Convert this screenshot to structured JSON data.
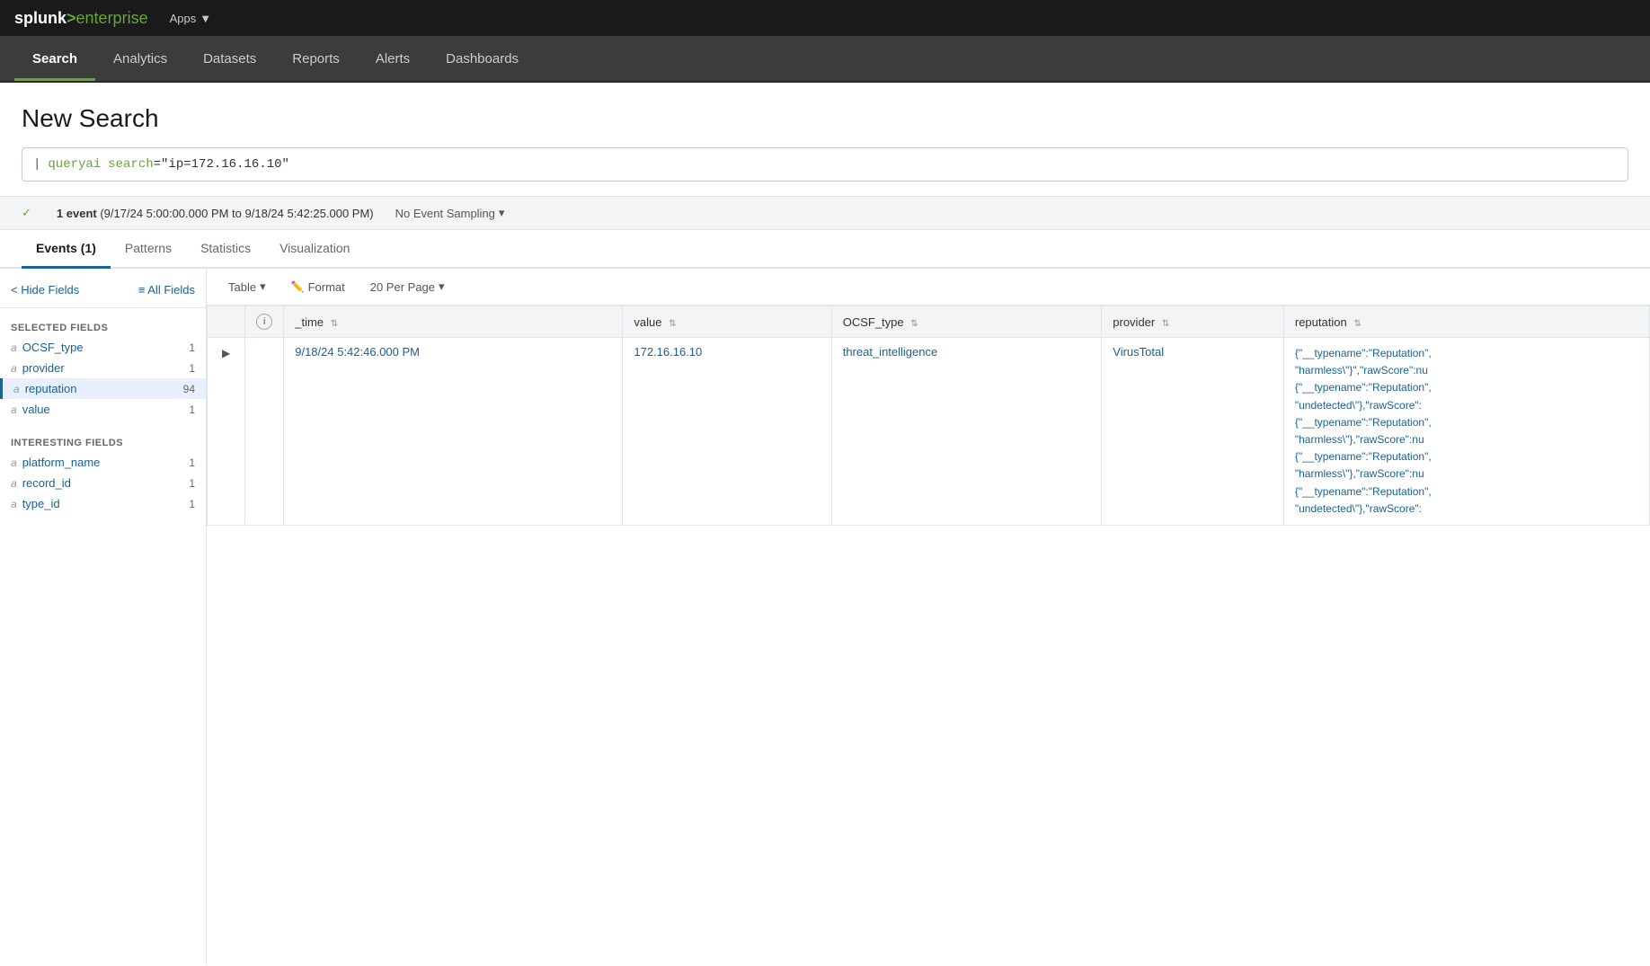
{
  "topbar": {
    "logo": {
      "splunk": "splunk",
      "arrow": ">",
      "enterprise": "enterprise"
    },
    "apps_label": "Apps",
    "apps_arrow": "▼"
  },
  "navbar": {
    "items": [
      {
        "id": "search",
        "label": "Search",
        "active": true
      },
      {
        "id": "analytics",
        "label": "Analytics",
        "active": false
      },
      {
        "id": "datasets",
        "label": "Datasets",
        "active": false
      },
      {
        "id": "reports",
        "label": "Reports",
        "active": false
      },
      {
        "id": "alerts",
        "label": "Alerts",
        "active": false
      },
      {
        "id": "dashboards",
        "label": "Dashboards",
        "active": false
      }
    ]
  },
  "page": {
    "title": "New Search",
    "search_query": "| queryai search=\"ip=172.16.16.10\"",
    "search_pipe": "|",
    "search_cmd": "queryai",
    "search_keyword": "search",
    "search_value": "=\"ip=172.16.16.10\"",
    "status_check": "✓",
    "status_event_count": "1 event",
    "status_time_range": "(9/17/24 5:00:00.000 PM to 9/18/24 5:42:25.000 PM)",
    "sampling_label": "No Event Sampling",
    "sampling_arrow": "▾"
  },
  "tabs": [
    {
      "id": "events",
      "label": "Events (1)",
      "active": true
    },
    {
      "id": "patterns",
      "label": "Patterns",
      "active": false
    },
    {
      "id": "statistics",
      "label": "Statistics",
      "active": false
    },
    {
      "id": "visualization",
      "label": "Visualization",
      "active": false
    }
  ],
  "left_panel": {
    "hide_fields_label": "< Hide Fields",
    "all_fields_label": "≡ All Fields",
    "selected_fields_label": "SELECTED FIELDS",
    "selected_fields": [
      {
        "type": "a",
        "name": "OCSF_type",
        "count": "1"
      },
      {
        "type": "a",
        "name": "provider",
        "count": "1"
      },
      {
        "type": "a",
        "name": "reputation",
        "count": "94",
        "selected": true
      },
      {
        "type": "a",
        "name": "value",
        "count": "1"
      }
    ],
    "interesting_fields_label": "INTERESTING FIELDS",
    "interesting_fields": [
      {
        "type": "a",
        "name": "platform_name",
        "count": "1"
      },
      {
        "type": "a",
        "name": "record_id",
        "count": "1"
      },
      {
        "type": "a",
        "name": "type_id",
        "count": "1"
      }
    ]
  },
  "table_toolbar": {
    "table_label": "Table",
    "format_label": "Format",
    "per_page_label": "20 Per Page",
    "table_arrow": "▾",
    "per_page_arrow": "▾"
  },
  "table": {
    "columns": [
      {
        "id": "expand",
        "label": ""
      },
      {
        "id": "info",
        "label": "i"
      },
      {
        "id": "time",
        "label": "_time",
        "sortable": true
      },
      {
        "id": "value",
        "label": "value",
        "sortable": true
      },
      {
        "id": "ocsf_type",
        "label": "OCSF_type",
        "sortable": true
      },
      {
        "id": "provider",
        "label": "provider",
        "sortable": true
      },
      {
        "id": "reputation",
        "label": "reputation",
        "sortable": true
      }
    ],
    "rows": [
      {
        "time": "9/18/24 5:42:46.000 PM",
        "value": "172.16.16.10",
        "ocsf_type": "threat_intelligence",
        "provider": "VirusTotal",
        "reputation": "{\"__typename\":\"Reputation\",\"harmless\\\"}\",\"rawScore\":nu {\"__typename\":\"Reputation\",\"undetected\\\"},\"rawScore\": {\"__typename\":\"Reputation\",\"harmless\\\"},\"rawScore\":nu {\"__typename\":\"Reputation\",\"harmless\\\"},\"rawScore\":nu {\"__typename\":\"Reputation\",\"undetected\\\"},\"rawScore\":"
      }
    ]
  }
}
